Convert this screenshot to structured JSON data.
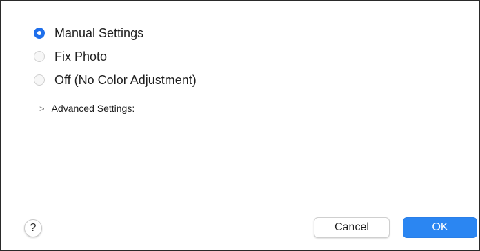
{
  "color_options": [
    {
      "label": "Manual Settings",
      "selected": true
    },
    {
      "label": "Fix Photo",
      "selected": false
    },
    {
      "label": "Off (No Color Adjustment)",
      "selected": false
    }
  ],
  "advanced": {
    "label": "Advanced Settings:",
    "chevron": ">"
  },
  "footer": {
    "help_label": "?",
    "cancel_label": "Cancel",
    "ok_label": "OK"
  },
  "colors": {
    "accent": "#2b86f2",
    "selected_radio": "#1f6feb"
  },
  "icons": {
    "help": "question-mark-icon",
    "disclosure": "chevron-right-icon"
  }
}
